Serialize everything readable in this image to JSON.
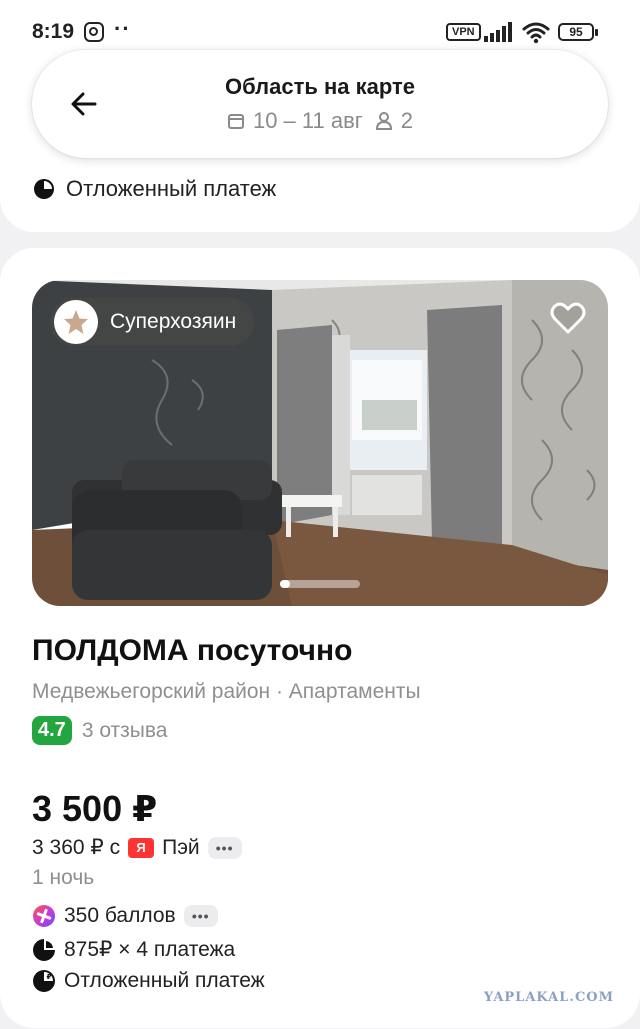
{
  "status_bar": {
    "time": "8:19",
    "dots": "··",
    "vpn": "VPN",
    "battery": "95"
  },
  "search": {
    "title": "Область на карте",
    "dates": "10 – 11 авг",
    "guests": "2"
  },
  "previous_listing": {
    "deferred_payment": "Отложенный платеж"
  },
  "listing": {
    "badge": "Суперхозяин",
    "title": "ПОЛДОМА посуточно",
    "subtitle": "Медвежьегорский район · Апартаменты",
    "rating": "4.7",
    "reviews": "3 отзыва",
    "price": "3 500 ₽",
    "pay_price": "3 360 ₽ с",
    "pay_logo": "Я",
    "pay_name": "Пэй",
    "more": "•••",
    "nights": "1 ночь",
    "perks": {
      "points": "350 баллов",
      "installments": "875₽ × 4 платежа",
      "deferred": "Отложенный платеж"
    }
  },
  "watermark": "YAPLAKAL.COM",
  "colors": {
    "rating_green": "#23a640",
    "yandex_red": "#ff3333",
    "background": "#f1f1f3"
  }
}
